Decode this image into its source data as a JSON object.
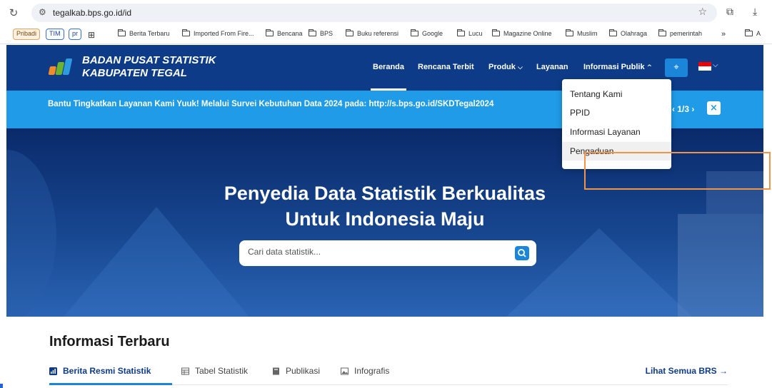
{
  "browser": {
    "url": "tegalkab.bps.go.id/id",
    "bookmarks": {
      "chips": [
        "Pribadi",
        "TIM",
        "pr"
      ],
      "folders": [
        "Berita Terbaru",
        "Imported From Fire...",
        "Bencana",
        "BPS",
        "Buku referensi",
        "Google",
        "Lucu",
        "Magazine Online",
        "Muslim",
        "Olahraga",
        "pemerintah"
      ],
      "overflow": "»",
      "last_folder": "A"
    }
  },
  "header": {
    "logo_line1": "BADAN PUSAT STATISTIK",
    "logo_line2": "KABUPATEN TEGAL",
    "menu": {
      "beranda": "Beranda",
      "rencana": "Rencana Terbit",
      "produk": "Produk",
      "layanan": "Layanan",
      "informasi": "Informasi Publik"
    }
  },
  "announcement": {
    "text": "Bantu Tingkatkan Layanan Kami Yuuk! Melalui Survei Kebutuhan Data 2024 pada: http://s.bps.go.id/SKDTegal2024",
    "pager": "1/3"
  },
  "dropdown": {
    "items": [
      "Tentang Kami",
      "PPID",
      "Informasi Layanan",
      "Pengaduan"
    ]
  },
  "hero": {
    "title_line1": "Penyedia Data Statistik Berkualitas",
    "title_line2": "Untuk Indonesia Maju",
    "search_placeholder": "Cari data statistik..."
  },
  "info": {
    "title": "Informasi Terbaru",
    "tabs": [
      "Berita Resmi Statistik",
      "Tabel Statistik",
      "Publikasi",
      "Infografis"
    ],
    "see_all": "Lihat Semua BRS →"
  },
  "colors": {
    "header_bg": "#0d3b87",
    "announcement_bg": "#1f9be7",
    "accent": "#1b86d9",
    "highlight": "#f0944a"
  }
}
